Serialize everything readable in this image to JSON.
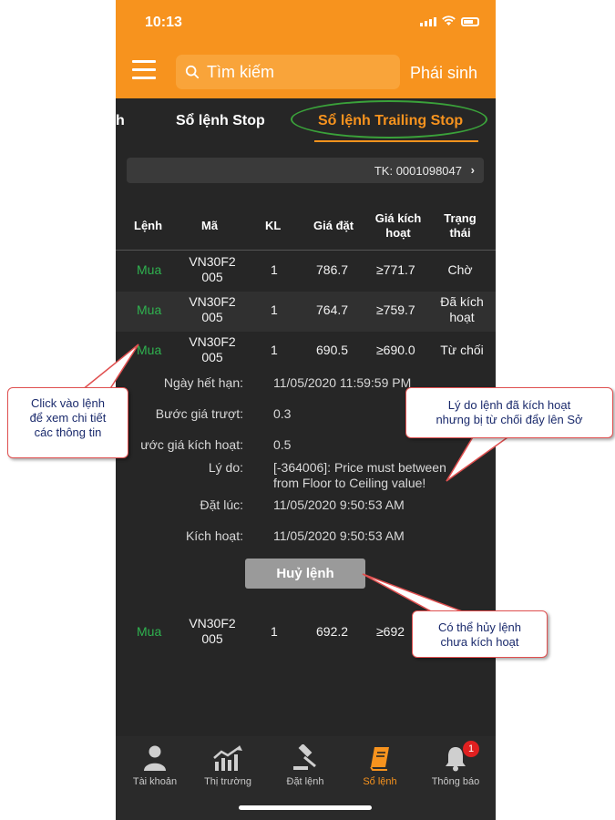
{
  "status_bar": {
    "time": "10:13"
  },
  "header": {
    "search_placeholder": "Tìm kiếm",
    "right_label": "Phái sinh"
  },
  "tabs": [
    {
      "label": "h"
    },
    {
      "label": "Sổ lệnh Stop"
    },
    {
      "label": "Sổ lệnh Trailing Stop",
      "active": true
    }
  ],
  "account": {
    "label": "TK: 0001098047",
    "chevron": "›"
  },
  "table": {
    "headers": {
      "order": "Lệnh",
      "code": "Mã",
      "qty": "KL",
      "price": "Giá đặt",
      "trigger": [
        "Giá kích",
        "hoạt"
      ],
      "status": [
        "Trạng",
        "thái"
      ]
    },
    "rows": [
      {
        "side": "Mua",
        "code": [
          "VN30F2",
          "005"
        ],
        "qty": "1",
        "price": "786.7",
        "trigger": "≥771.7",
        "status": [
          "Chờ",
          ""
        ]
      },
      {
        "side": "Mua",
        "code": [
          "VN30F2",
          "005"
        ],
        "qty": "1",
        "price": "764.7",
        "trigger": "≥759.7",
        "status": [
          "Đã kích",
          "hoạt"
        ]
      },
      {
        "side": "Mua",
        "code": [
          "VN30F2",
          "005"
        ],
        "qty": "1",
        "price": "690.5",
        "trigger": "≥690.0",
        "status": [
          "Từ chối",
          ""
        ]
      }
    ],
    "last_row": {
      "side": "Mua",
      "code": [
        "VN30F2",
        "005"
      ],
      "qty": "1",
      "price": "692.2",
      "trigger": "≥692"
    }
  },
  "details": {
    "expiry_label": "Ngày hết hạn:",
    "expiry_value": "11/05/2020 11:59:59 PM",
    "trail_label": "Bước giá trượt:",
    "trail_value": "0.3",
    "trigger_step_label": "ước giá kích hoạt:",
    "trigger_step_value": "0.5",
    "reason_label": "Lý do:",
    "reason_line1": "[-364006]: Price must between",
    "reason_line2": "from Floor to Ceiling value!",
    "placed_label": "Đặt lúc:",
    "placed_value": "11/05/2020 9:50:53 AM",
    "activated_label": "Kích hoạt:",
    "activated_value": "11/05/2020 9:50:53 AM",
    "cancel_button": "Huỷ lệnh"
  },
  "bottom_nav": [
    {
      "label": "Tài khoản",
      "icon": "person-icon"
    },
    {
      "label": "Thị trường",
      "icon": "chart-icon"
    },
    {
      "label": "Đặt lệnh",
      "icon": "gavel-icon"
    },
    {
      "label": "Sổ lệnh",
      "icon": "book-icon",
      "active": true
    },
    {
      "label": "Thông báo",
      "icon": "bell-icon",
      "badge": "1"
    }
  ],
  "annotations": {
    "click_hint": [
      "Click vào lệnh",
      "để xem chi tiết",
      "các thông tin"
    ],
    "reject_hint": [
      "Lý do lệnh đã kích hoạt",
      "nhưng bị từ chối đẩy lên Sở"
    ],
    "cancel_hint": [
      "Có thể hủy lệnh",
      "chưa kích hoạt"
    ]
  },
  "colors": {
    "accent": "#f7931e",
    "buy": "#2fb24f",
    "badge": "#e02020",
    "highlight_ellipse": "#3aa13a"
  }
}
